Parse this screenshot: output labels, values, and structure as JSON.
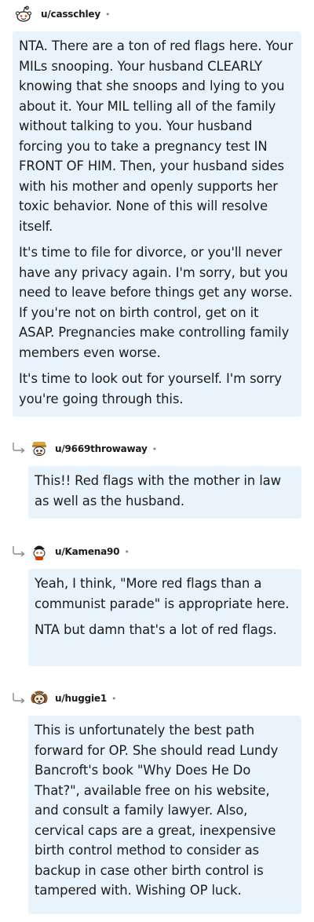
{
  "comments": [
    {
      "username": "u/casschley",
      "separator": "•",
      "paragraphs": [
        "NTA. There are a ton of red flags here. Your MILs snooping. Your husband CLEARLY knowing that she snoops and lying to you about it. Your MIL telling all of the family without talking to you. Your husband forcing you to take a pregnancy test IN FRONT OF HIM. Then, your husband sides with his mother and openly supports her toxic behavior. None of this will resolve itself.",
        "It's time to file for divorce, or you'll never have any privacy again. I'm sorry, but you need to leave before things get any worse. If you're not on birth control, get on it ASAP. Pregnancies make controlling family members even worse.",
        "It's time to look out for yourself. I'm sorry you're going through this."
      ]
    },
    {
      "username": "u/9669throwaway",
      "separator": "•",
      "paragraphs": [
        "This!! Red flags with the mother in law as well as the husband."
      ]
    },
    {
      "username": "u/Kamena90",
      "separator": "•",
      "paragraphs": [
        "Yeah, I think, \"More red flags than a communist parade\" is appropriate here.",
        "NTA but damn that's a lot of red flags."
      ]
    },
    {
      "username": "u/huggie1",
      "separator": "•",
      "paragraphs": [
        "This is unfortunately the best path forward for OP. She should read Lundy Bancroft's book \"Why Does He Do That?\", available free on his website, and consult a family lawyer. Also, cervical caps are a great, inexpensive birth control method to consider as backup in case other birth control is tampered with. Wishing OP luck."
      ]
    }
  ],
  "icons": {
    "reply": "reply-arrow-icon",
    "avatar": "snoo-avatar-icon"
  },
  "colors": {
    "bubble": "#e9f3fb",
    "text": "#1c1c1c",
    "meta": "#878a8c"
  }
}
